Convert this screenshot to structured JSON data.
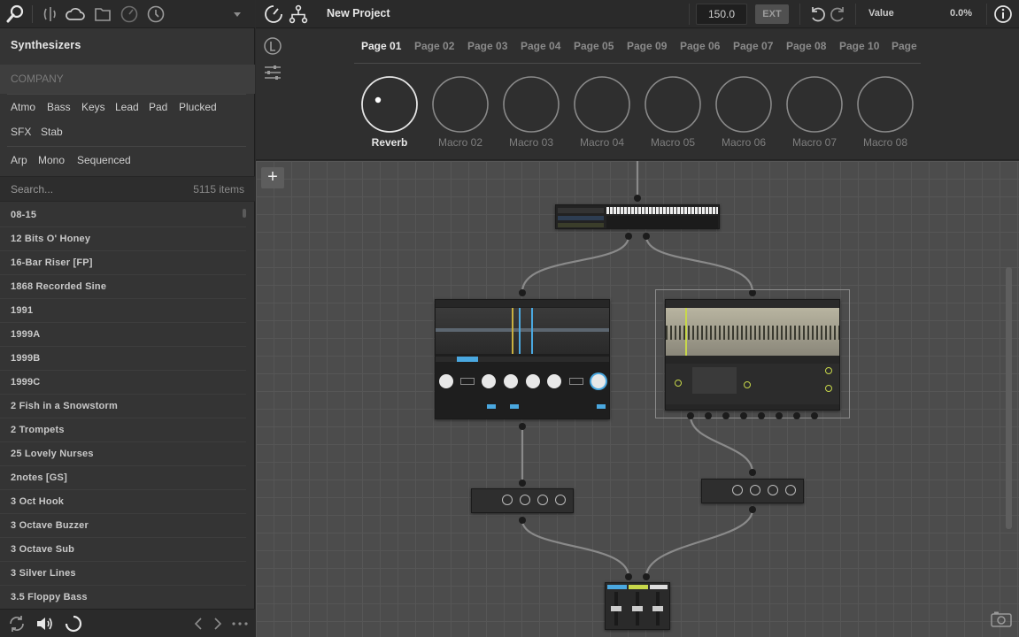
{
  "browser": {
    "title": "Synthesizers",
    "company_label": "COMPANY",
    "tags_row1": [
      "Atmo",
      "Bass",
      "Keys",
      "Lead",
      "Pad",
      "Plucked"
    ],
    "tags_row2": [
      "SFX",
      "Stab"
    ],
    "tags_row3": [
      "Arp",
      "Mono",
      "Sequenced"
    ],
    "search_placeholder": "Search...",
    "item_count": "5115 items",
    "presets": [
      "08-15",
      "12 Bits O' Honey",
      "16-Bar Riser [FP]",
      "1868 Recorded Sine",
      "1991",
      "1999A",
      "1999B",
      "1999C",
      "2 Fish in a Snowstorm",
      "2 Trompets",
      "25 Lovely Nurses",
      "2notes [GS]",
      "3 Oct Hook",
      "3 Octave Buzzer",
      "3 Octave Sub",
      "3 Silver Lines",
      "3.5 Floppy Bass"
    ],
    "toolbar_icons": [
      "search-icon",
      "library-icon",
      "cloud-icon",
      "folder-icon",
      "meter-icon",
      "clock-icon",
      "dropdown-icon"
    ],
    "bottom_icons": [
      "refresh-icon",
      "speaker-icon",
      "loading-icon",
      "prev-icon",
      "next-icon",
      "more-icon"
    ]
  },
  "topbar": {
    "project_name": "New Project",
    "tempo": "150.0",
    "ext_label": "EXT",
    "value_label": "Value",
    "value": "0.0%"
  },
  "macros": {
    "pages": [
      "Page 01",
      "Page 02",
      "Page 03",
      "Page 04",
      "Page 05",
      "Page 09",
      "Page 06",
      "Page 07",
      "Page 08",
      "Page 10",
      "Page"
    ],
    "active_page": 0,
    "knobs": [
      {
        "label": "Reverb",
        "active": true
      },
      {
        "label": "Macro 02",
        "active": false
      },
      {
        "label": "Macro 03",
        "active": false
      },
      {
        "label": "Macro 04",
        "active": false
      },
      {
        "label": "Macro 05",
        "active": false
      },
      {
        "label": "Macro 06",
        "active": false
      },
      {
        "label": "Macro 07",
        "active": false
      },
      {
        "label": "Macro 08",
        "active": false
      }
    ]
  },
  "colors": {
    "accent_blue": "#4aa8e0",
    "accent_yellow": "#c8d84a",
    "graph_bg": "#4c4c4c"
  }
}
